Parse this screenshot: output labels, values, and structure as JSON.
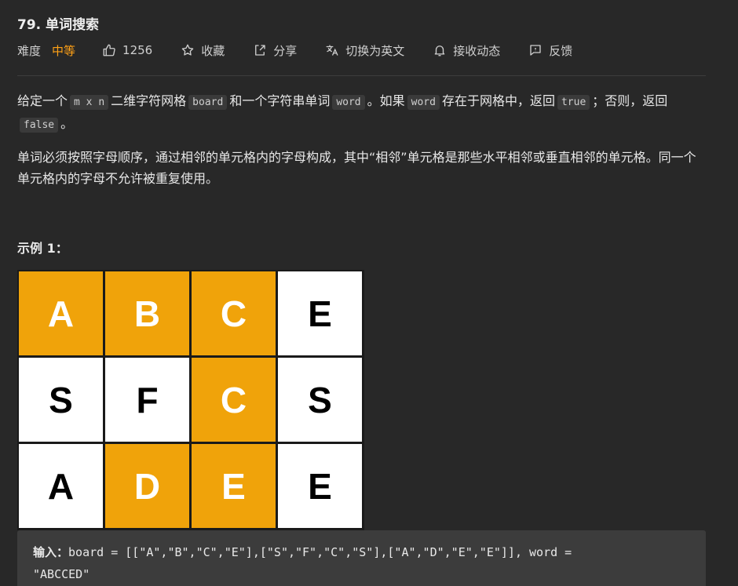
{
  "problem": {
    "title": "79. 单词搜索",
    "difficulty_label": "难度",
    "difficulty_value": "中等",
    "likes": "1256",
    "favorite_label": "收藏",
    "share_label": "分享",
    "translate_label": "切换为英文",
    "subscribe_label": "接收动态",
    "feedback_label": "反馈"
  },
  "description": {
    "p1_a": "给定一个",
    "p1_code_mxn": "m x n",
    "p1_b": "二维字符网格",
    "p1_code_board": "board",
    "p1_c": "和一个字符串单词",
    "p1_code_word1": "word",
    "p1_d": "。如果",
    "p1_code_word2": "word",
    "p1_e": "存在于网格中，返回",
    "p1_code_true": "true",
    "p1_f": "；否则，返回",
    "p1_code_false": "false",
    "p1_g": "。",
    "p2": "单词必须按照字母顺序，通过相邻的单元格内的字母构成，其中“相邻”单元格是那些水平相邻或垂直相邻的单元格。同一个单元格内的字母不允许被重复使用。"
  },
  "example": {
    "title": "示例 1：",
    "grid": [
      [
        "A",
        "B",
        "C",
        "E"
      ],
      [
        "S",
        "F",
        "C",
        "S"
      ],
      [
        "A",
        "D",
        "E",
        "E"
      ]
    ],
    "highlight": [
      [
        true,
        true,
        true,
        false
      ],
      [
        false,
        false,
        true,
        false
      ],
      [
        false,
        true,
        true,
        false
      ]
    ],
    "highlight_color": "#f0a30a",
    "input_label": "输入：",
    "input_text": "board = [[\"A\",\"B\",\"C\",\"E\"],[\"S\",\"F\",\"C\",\"S\"],[\"A\",\"D\",\"E\",\"E\"]], word = ",
    "input_text_2": "\"ABCCED\""
  },
  "colors": {
    "background": "#282828",
    "accent_orange": "#ffa116"
  }
}
